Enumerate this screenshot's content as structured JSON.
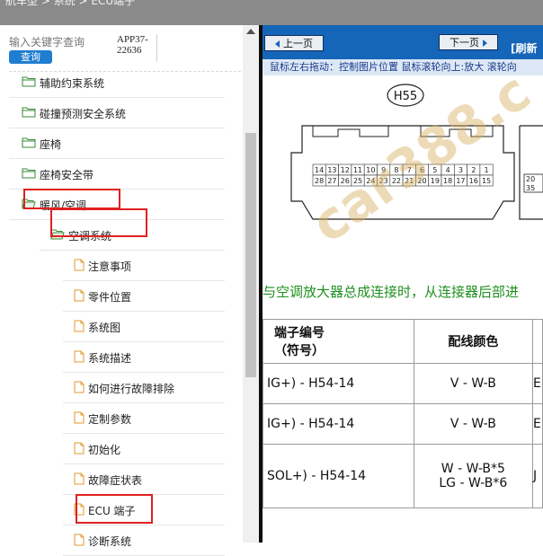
{
  "topbar": {
    "breadcrumb": "航车型 > 系统 > ECU端子"
  },
  "sidebar": {
    "search_placeholder": "输入关键字查询",
    "search_button": "查询",
    "app_code_line1": "APP37-",
    "app_code_line2": "22636",
    "items": [
      {
        "label": "辅助约束系统",
        "type": "folder"
      },
      {
        "label": "碰撞预测安全系统",
        "type": "folder"
      },
      {
        "label": "座椅",
        "type": "folder"
      },
      {
        "label": "座椅安全带",
        "type": "folder"
      },
      {
        "label": "暖风/空调",
        "type": "folder-open",
        "highlighted": true
      },
      {
        "label": "空调系统",
        "type": "folder-open",
        "highlighted": true
      },
      {
        "label": "注意事项",
        "type": "doc"
      },
      {
        "label": "零件位置",
        "type": "doc"
      },
      {
        "label": "系统图",
        "type": "doc"
      },
      {
        "label": "系统描述",
        "type": "doc"
      },
      {
        "label": "如何进行故障排除",
        "type": "doc"
      },
      {
        "label": "定制参数",
        "type": "doc"
      },
      {
        "label": "初始化",
        "type": "doc"
      },
      {
        "label": "故障症状表",
        "type": "doc"
      },
      {
        "label": "ECU 端子",
        "type": "doc",
        "highlighted": true
      },
      {
        "label": "诊断系统",
        "type": "doc"
      }
    ]
  },
  "viewer": {
    "prev_label": "上一页",
    "next_label": "下一页",
    "refresh_label": "[刷新",
    "hint": "鼠标左右拖动：控制图片位置 鼠标滚轮向上:放大  滚轮向",
    "connector_label": "H55",
    "pins_top": [
      "14",
      "13",
      "12",
      "11",
      "10",
      "9",
      "8",
      "7",
      "6",
      "5",
      "4",
      "3",
      "2",
      "1"
    ],
    "pins_bottom": [
      "28",
      "27",
      "26",
      "25",
      "24",
      "23",
      "22",
      "21",
      "20",
      "19",
      "18",
      "17",
      "16",
      "15"
    ],
    "pins_right_top": "20",
    "pins_right_bottom": "35",
    "heading": "与空调放大器总成连接时，从连接器后部进",
    "watermark": "car388.c",
    "table": {
      "header_1": "端子编号\n（符号）",
      "header_2": "配线颜色",
      "rows": [
        {
          "terminal": "IG+) - H54-14",
          "color": "V - W-B",
          "extra": "E"
        },
        {
          "terminal": "IG+) - H54-14",
          "color": "V - W-B",
          "extra": "E"
        },
        {
          "terminal": "SOL+) - H54-14",
          "color": "W - W-B*5\nLG - W-B*6",
          "extra": "J"
        }
      ]
    }
  },
  "colors": {
    "nav_blue": "#1565b8",
    "highlight_red": "#e02020",
    "heading_green": "#1f8f1f",
    "search_button_blue": "#1f7ed0"
  }
}
